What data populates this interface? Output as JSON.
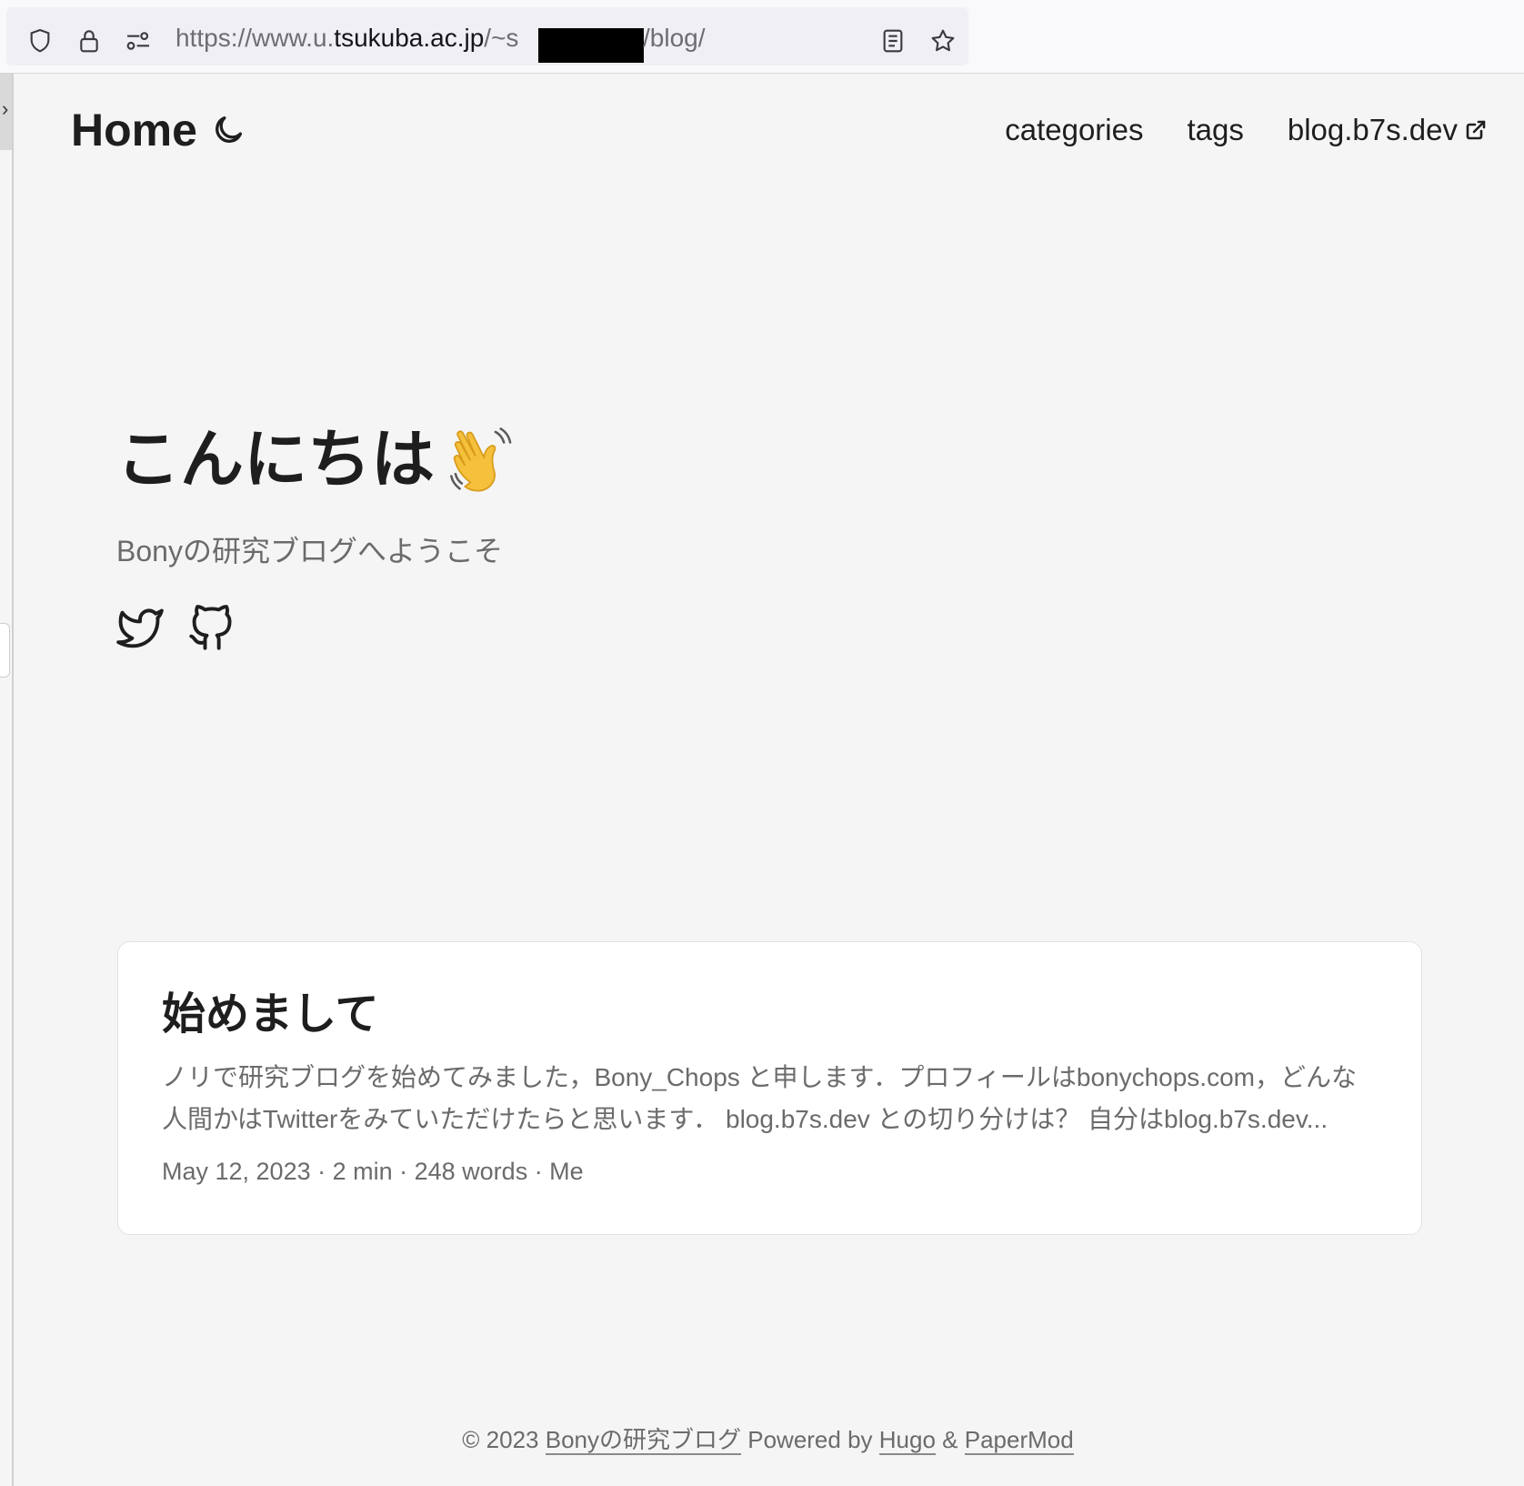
{
  "browser": {
    "url_prefix": "https://www.u.",
    "url_domain": "tsukuba.ac.jp",
    "url_mid": "/~s",
    "url_path": "/blog/",
    "icons": [
      "shield-icon",
      "lock-icon",
      "permissions-icon",
      "reader-view-icon",
      "bookmark-star-icon"
    ]
  },
  "header": {
    "logo": "Home",
    "theme_icon": "moon-icon",
    "menu": [
      {
        "label": "categories"
      },
      {
        "label": "tags"
      },
      {
        "label": "blog.b7s.dev",
        "external": true
      }
    ]
  },
  "hero": {
    "title": "こんにちは",
    "emoji": "waving-hand",
    "subtitle": "Bonyの研究ブログへようこそ",
    "socials": [
      "twitter-icon",
      "github-icon"
    ]
  },
  "posts": [
    {
      "title": "始めまして",
      "excerpt": "ノリで研究ブログを始めてみました，Bony_Chops と申します．プロフィールはbonychops.com，どんな人間かはTwitterをみていただけたらと思います． blog.b7s.dev との切り分けは？ 自分はblog.b7s.dev...",
      "meta": "May 12, 2023 · 2 min · 248 words · Me"
    }
  ],
  "footer": {
    "copyright": "© 2023",
    "site_link": "Bonyの研究ブログ",
    "powered_by": "Powered by",
    "hugo": "Hugo",
    "amp": "&",
    "theme": "PaperMod"
  }
}
